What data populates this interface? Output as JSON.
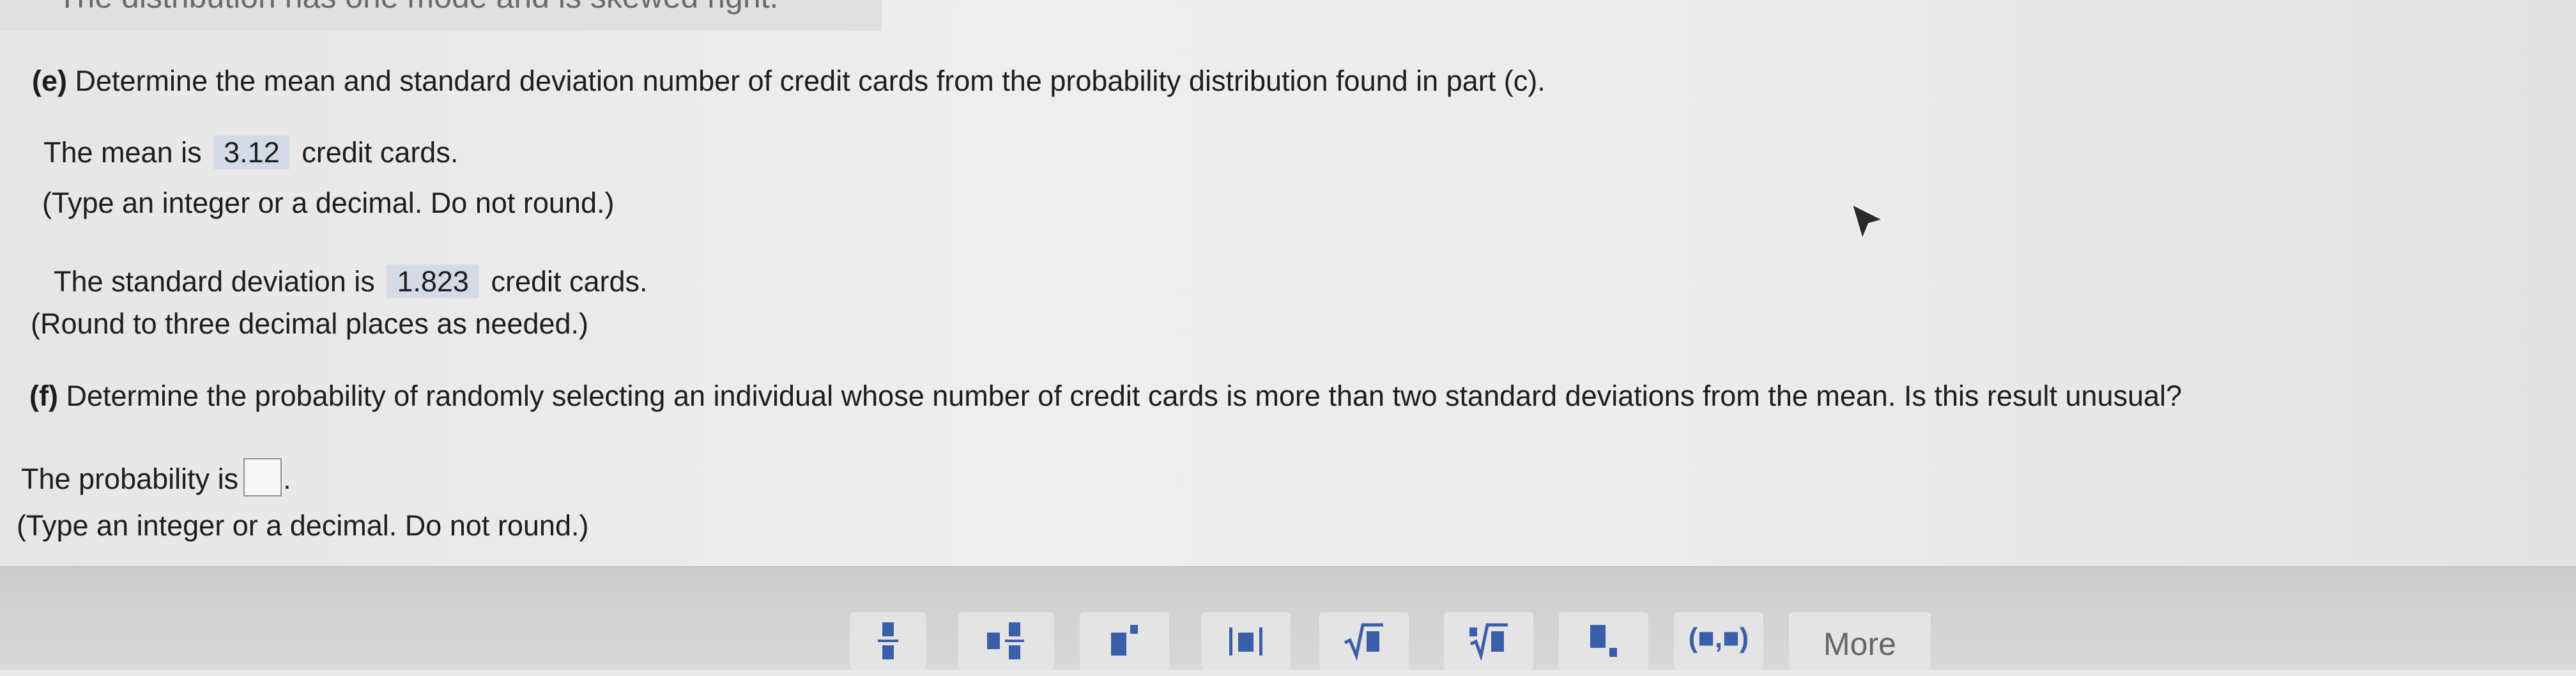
{
  "header_fragment": "The distribution has one mode and is skewed right.",
  "part_e": {
    "letter": "(e)",
    "question": "Determine the mean and standard deviation number of credit cards from the probability distribution found in part (c).",
    "mean_prefix": "The mean is",
    "mean_value": "3.12",
    "mean_suffix": "credit cards.",
    "mean_hint": "(Type an integer or a decimal. Do not round.)",
    "sd_prefix": "The standard deviation is",
    "sd_value": "1.823",
    "sd_suffix": "credit cards.",
    "sd_hint": "(Round to three decimal places as needed.)"
  },
  "part_f": {
    "letter": "(f)",
    "question": "Determine the probability of randomly selecting an individual whose number of credit cards is more than two standard deviations from the mean. Is this result unusual?",
    "prob_prefix": "The probability is",
    "prob_value": "",
    "prob_suffix": ".",
    "prob_hint": "(Type an integer or a decimal. Do not round.)"
  },
  "toolbar": {
    "buttons": [
      "fraction-icon",
      "mixed-number-icon",
      "exponent-icon",
      "absolute-value-icon",
      "square-root-icon",
      "nth-root-icon",
      "subscript-icon",
      "ordered-pair-icon"
    ],
    "ordered_pair_label": "(■,■)",
    "more_label": "More"
  },
  "colors": {
    "answer_highlight": "#d4dbe6",
    "toolbar_bg": "#d2d2d2",
    "toolbar_icon": "#3b5ea8"
  }
}
